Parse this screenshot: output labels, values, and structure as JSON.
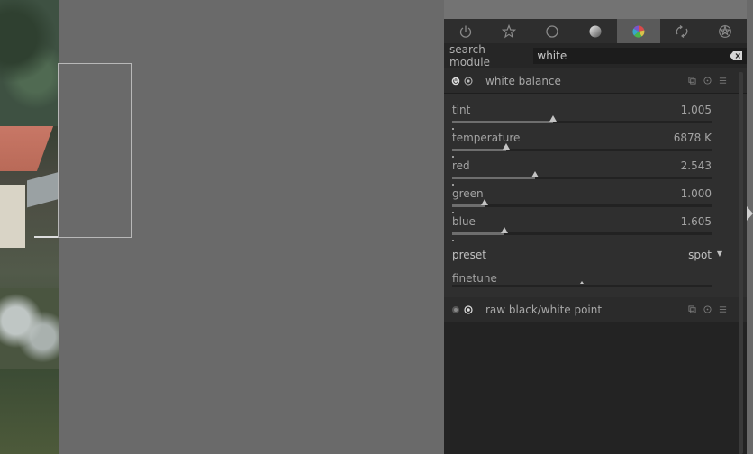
{
  "tabs": [
    {
      "icon": "power-icon",
      "active": false
    },
    {
      "icon": "favorites-star-icon",
      "active": false
    },
    {
      "icon": "basic-circle-icon",
      "active": false
    },
    {
      "icon": "tone-sphere-icon",
      "active": false
    },
    {
      "icon": "color-wheel-icon",
      "active": true
    },
    {
      "icon": "correct-loop-icon",
      "active": false
    },
    {
      "icon": "effect-pentagram-icon",
      "active": false
    }
  ],
  "search": {
    "label": "search module",
    "value": "white"
  },
  "white_balance": {
    "title": "white balance",
    "sliders": [
      {
        "label": "tint",
        "value": "1.005",
        "position": 0.39
      },
      {
        "label": "temperature",
        "value": "6878 K",
        "position": 0.21
      },
      {
        "label": "red",
        "value": "2.543",
        "position": 0.32
      },
      {
        "label": "green",
        "value": "1.000",
        "position": 0.125
      },
      {
        "label": "blue",
        "value": "1.605",
        "position": 0.2
      }
    ],
    "preset_label": "preset",
    "preset_value": "spot",
    "finetune_label": "finetune"
  },
  "raw_module": {
    "title": "raw black/white point"
  },
  "colors": {
    "accent_tab": "#5a5a5a",
    "panel_bg": "#232323",
    "module_bg": "#2f2f2f"
  }
}
